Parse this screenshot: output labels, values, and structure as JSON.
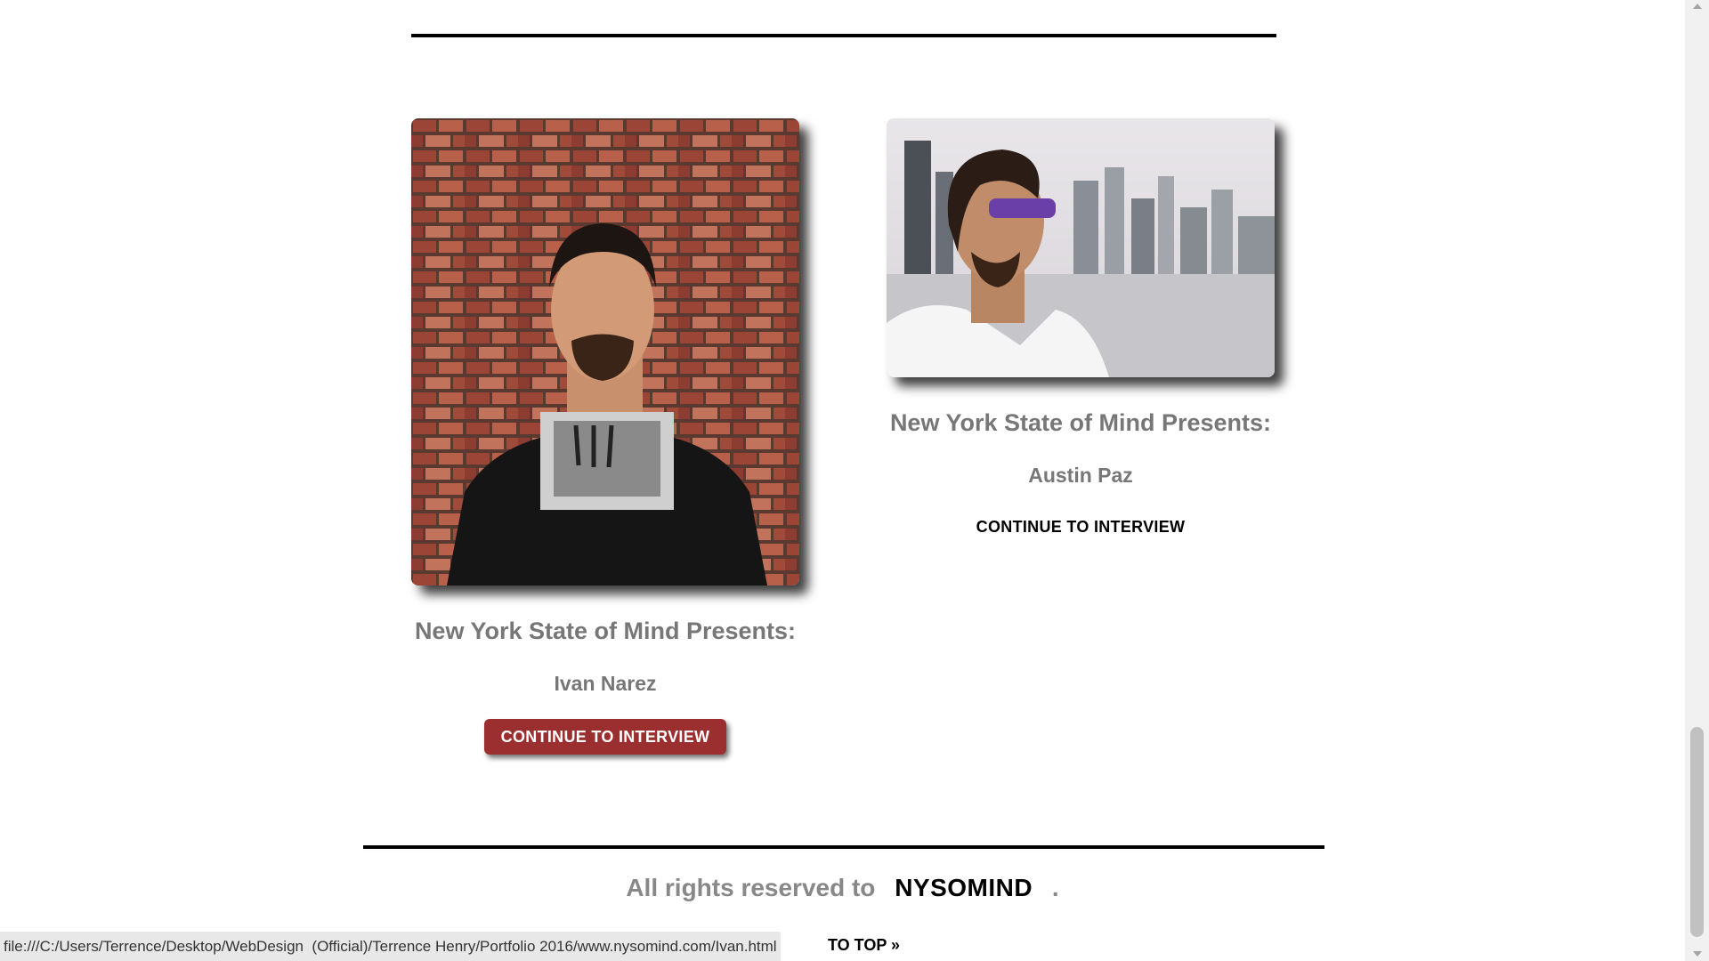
{
  "interviews": [
    {
      "presents": "New York State of Mind Presents:",
      "name": "Ivan Narez",
      "cta": "CONTINUE TO INTERVIEW",
      "photo_icon": "portrait-brick-wall"
    },
    {
      "presents": "New York State of Mind Presents:",
      "name": "Austin Paz",
      "cta": "CONTINUE TO INTERVIEW",
      "photo_icon": "portrait-city-skyline"
    }
  ],
  "footer": {
    "prefix": "All rights reserved to",
    "brand": "NYSOMIND",
    "suffix": ".",
    "back_to_top": "TO TOP »"
  },
  "status_bar": {
    "url": "file:///C:/Users/Terrence/Desktop/WebDesign  (Official)/Terrence Henry/Portfolio 2016/www.nysomind.com/Ivan.html"
  },
  "colors": {
    "cta_button_bg": "#9b2e2e",
    "heading_gray": "#777777",
    "rule": "#000000"
  }
}
